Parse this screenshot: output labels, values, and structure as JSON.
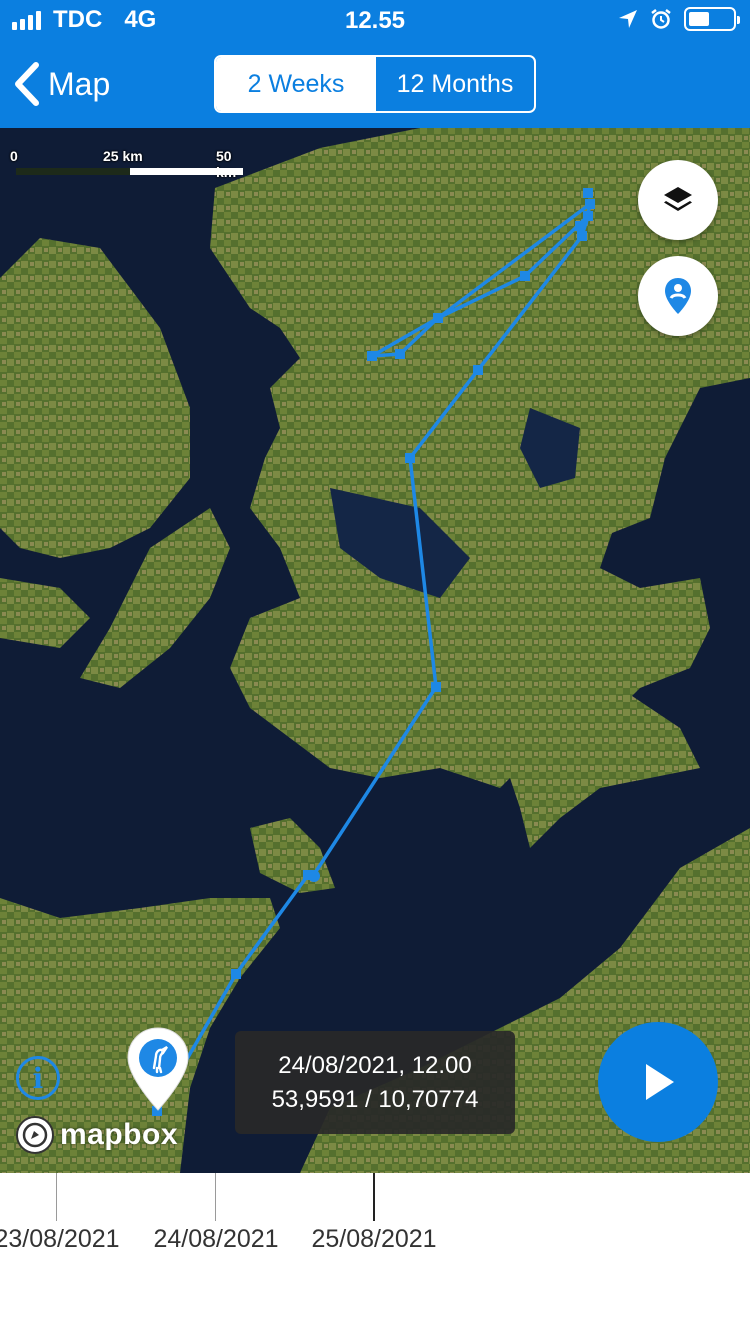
{
  "status": {
    "carrier": "TDC",
    "network": "4G",
    "time": "12.55",
    "battery_level": 0.45
  },
  "nav": {
    "back_label": "Map",
    "segments": [
      {
        "label": "2 Weeks",
        "active": true
      },
      {
        "label": "12 Months",
        "active": false
      }
    ]
  },
  "map": {
    "scale": {
      "zero": "0",
      "mid": "25 km",
      "max": "50 km"
    },
    "attribution": "mapbox",
    "route_color": "#1e88e5",
    "info_icon": "info-circle-icon",
    "layers_icon": "layers-icon",
    "locate_icon": "location-pin-icon",
    "marker_icon": "stork-icon"
  },
  "tooltip": {
    "datetime": "24/08/2021, 12.00",
    "coords": "53,9591 / 10,70774"
  },
  "play": {
    "icon": "play-icon",
    "color": "#0b7fe0"
  },
  "timeline": {
    "dates": [
      "23/08/2021",
      "24/08/2021",
      "25/08/2021"
    ]
  }
}
